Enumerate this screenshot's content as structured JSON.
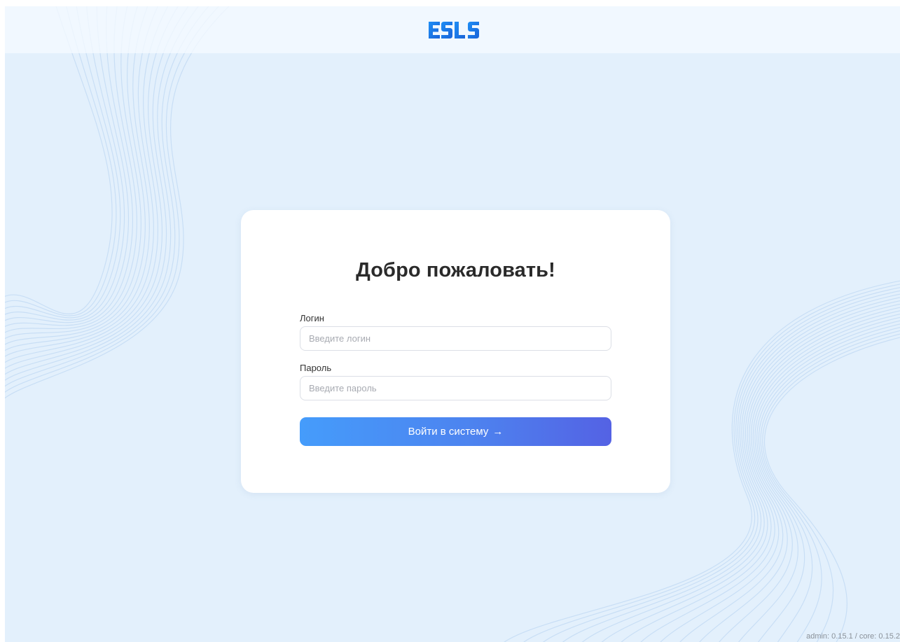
{
  "header": {
    "logo_text": "ESLS"
  },
  "login_card": {
    "title": "Добро пожаловать!",
    "login_label": "Логин",
    "login_placeholder": "Введите логин",
    "login_value": "",
    "password_label": "Пароль",
    "password_placeholder": "Введите пароль",
    "password_value": "",
    "submit_label": "Войти в систему",
    "submit_icon": "arrow-right-icon"
  },
  "footer": {
    "version_text": "admin: 0.15.1 / core: 0.15.2"
  },
  "colors": {
    "background": "#e3f0fc",
    "header": "#f4f9fe",
    "card": "#ffffff",
    "brand_blue": "#1f7ff0",
    "button_gradient_start": "#459cfb",
    "button_gradient_end": "#5462e4",
    "title_text": "#2a2a2a",
    "wave_lines": "#c6ddf5"
  }
}
